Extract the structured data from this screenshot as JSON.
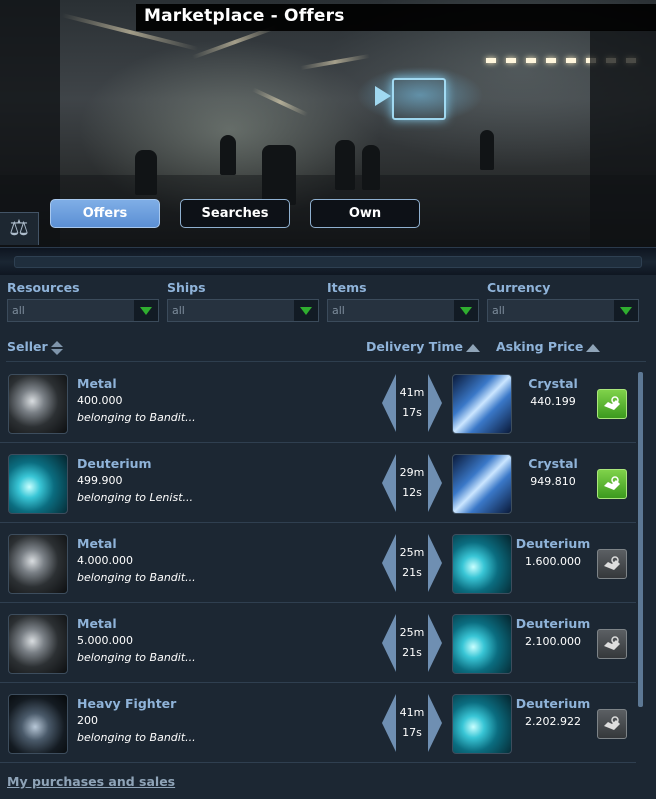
{
  "window": {
    "title": "Marketplace - Offers"
  },
  "tabs": [
    {
      "label": "Offers",
      "active": true
    },
    {
      "label": "Searches",
      "active": false
    },
    {
      "label": "Own",
      "active": false
    }
  ],
  "filters": [
    {
      "label": "Resources",
      "value": "all"
    },
    {
      "label": "Ships",
      "value": "all"
    },
    {
      "label": "Items",
      "value": "all"
    },
    {
      "label": "Currency",
      "value": "all"
    }
  ],
  "columns": {
    "seller": "Seller",
    "delivery": "Delivery Time",
    "price": "Asking Price"
  },
  "offers": [
    {
      "item": "Metal",
      "amount": "400.000",
      "owner": "belonging to Bandit...",
      "time_min": "41m",
      "time_sec": "17s",
      "price_item": "Crystal",
      "price_value": "440.199",
      "affordable": true
    },
    {
      "item": "Deuterium",
      "amount": "499.900",
      "owner": "belonging to Lenist...",
      "time_min": "29m",
      "time_sec": "12s",
      "price_item": "Crystal",
      "price_value": "949.810",
      "affordable": true
    },
    {
      "item": "Metal",
      "amount": "4.000.000",
      "owner": "belonging to Bandit...",
      "time_min": "25m",
      "time_sec": "21s",
      "price_item": "Deuterium",
      "price_value": "1.600.000",
      "affordable": false
    },
    {
      "item": "Metal",
      "amount": "5.000.000",
      "owner": "belonging to Bandit...",
      "time_min": "25m",
      "time_sec": "21s",
      "price_item": "Deuterium",
      "price_value": "2.100.000",
      "affordable": false
    },
    {
      "item": "Heavy Fighter",
      "amount": "200",
      "owner": "belonging to Bandit...",
      "time_min": "41m",
      "time_sec": "17s",
      "price_item": "Deuterium",
      "price_value": "2.202.922",
      "affordable": false
    }
  ],
  "footer": {
    "link": "My purchases and sales"
  },
  "colors": {
    "accent": "#8fb3d9",
    "tab_active": "#6b9ddb",
    "buy_green": "#4caf2a",
    "buy_gray": "#4a4e52"
  }
}
